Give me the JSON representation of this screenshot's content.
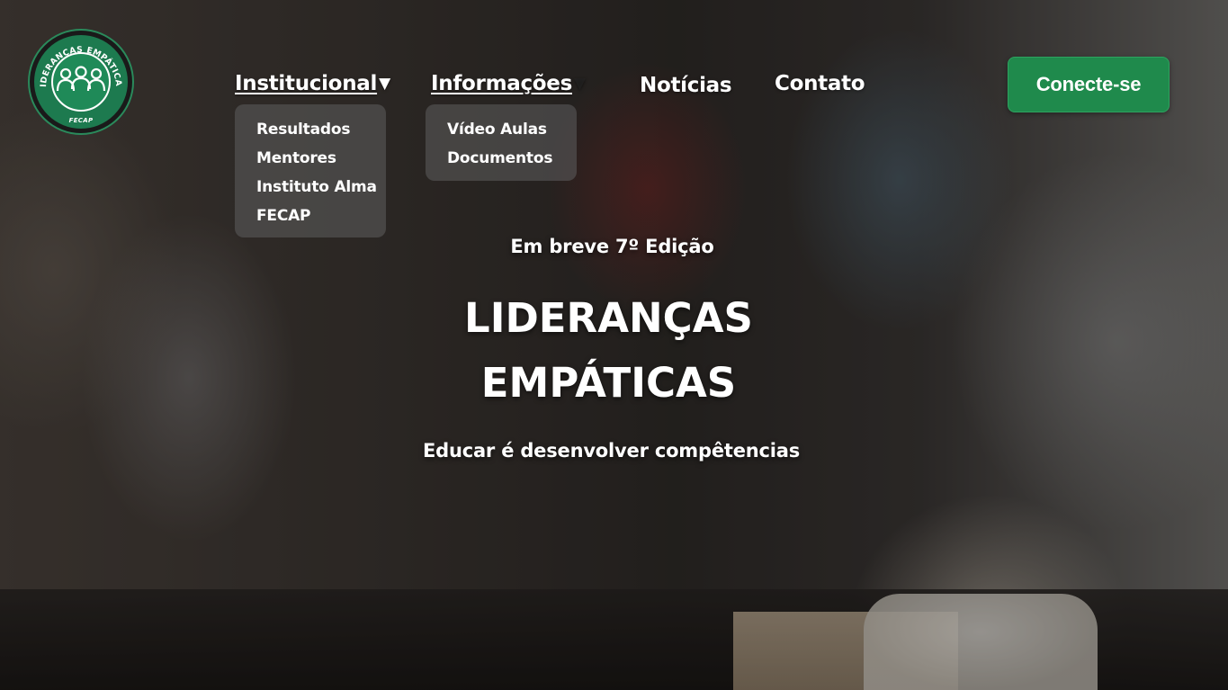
{
  "brand": {
    "logo_ring_text": "LIDERANÇAS EMPÁTICAS",
    "logo_sub_text": "FECAP",
    "logo_color": "#1d7a4f"
  },
  "nav": {
    "items": [
      {
        "label": "Institucional",
        "has_caret": true,
        "caret": "▼",
        "underlined": true,
        "dropdown": [
          "Resultados",
          "Mentores",
          "Instituto Alma",
          "FECAP"
        ]
      },
      {
        "label": "Informações",
        "has_caret": true,
        "caret": "▼",
        "underlined": true,
        "dropdown": [
          "Vídeo Aulas",
          "Documentos"
        ]
      },
      {
        "label": "Notícias",
        "has_caret": false,
        "underlined": false
      },
      {
        "label": "Contato",
        "has_caret": false,
        "underlined": false
      }
    ]
  },
  "cta": {
    "label": "Conecte-se",
    "color": "#1f8a4c"
  },
  "hero": {
    "kicker": "Em breve 7º Edição",
    "headline_line1": "LIDERANÇAS",
    "headline_line2": "EMPÁTICAS",
    "tagline": "Educar é desenvolver compêtencias"
  }
}
